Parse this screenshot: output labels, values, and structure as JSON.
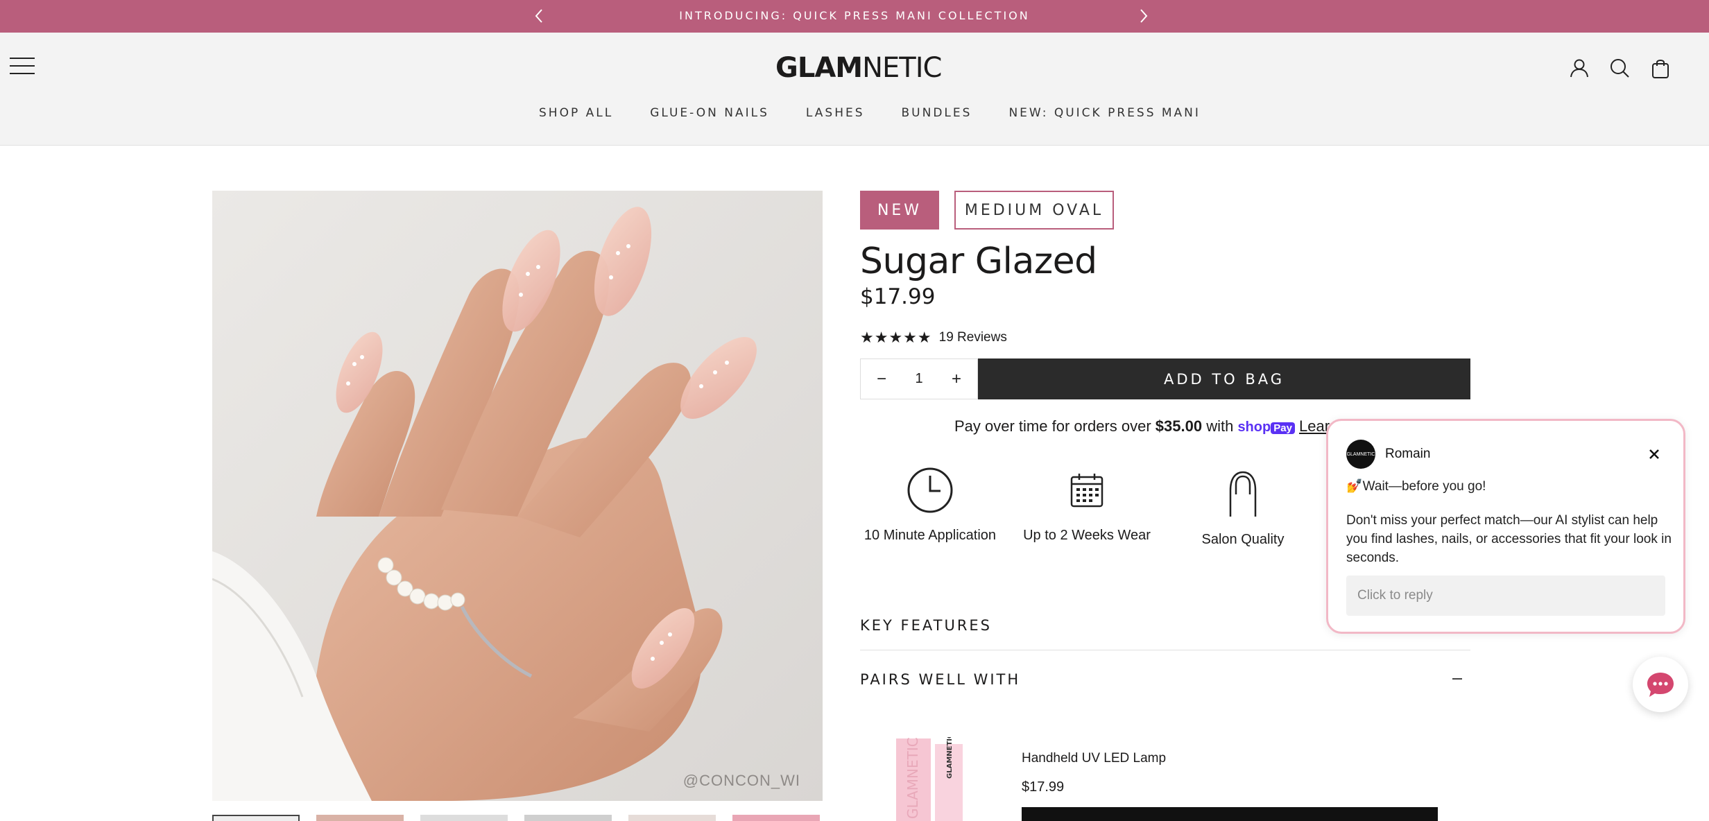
{
  "announcement": {
    "text": "INTRODUCING: QUICK PRESS MANI COLLECTION",
    "prev_icon": "chevron-left-icon",
    "next_icon": "chevron-right-icon"
  },
  "header": {
    "logo_bold": "GLAM",
    "logo_light": "NETIC",
    "nav": [
      "SHOP ALL",
      "GLUE-ON NAILS",
      "LASHES",
      "BUNDLES",
      "NEW: QUICK PRESS MANI"
    ],
    "icons": [
      "menu-icon",
      "account-icon",
      "search-icon",
      "bag-icon"
    ]
  },
  "product": {
    "badge_new": "NEW",
    "badge_shape": "MEDIUM OVAL",
    "title": "Sugar Glazed",
    "price": "$17.99",
    "stars": "★★★★★",
    "rating": 4.5,
    "reviews": "19 Reviews",
    "quantity": "1",
    "add_to_bag": "ADD TO BAG",
    "image_credit": "@CONCON_WI",
    "thumbnail_count": 6
  },
  "shoppay": {
    "prefix": "Pay over time for orders over ",
    "amount": "$35.00",
    "suffix": " with ",
    "brand_shop": "shop",
    "brand_pay": "Pay",
    "learn": "Learn more"
  },
  "features": [
    {
      "label": "10 Minute Application",
      "icon": "clock-icon"
    },
    {
      "label": "Up to 2 Weeks Wear",
      "icon": "calendar-icon"
    },
    {
      "label": "Salon Quality",
      "icon": "nail-icon"
    }
  ],
  "accordions": {
    "key_features": "KEY FEATURES",
    "pairs_well": "PAIRS WELL WITH"
  },
  "pair_item": {
    "name": "Handheld UV LED Lamp",
    "price": "$17.99",
    "packaging_text": "GLAMNETIC"
  },
  "chat": {
    "avatar_text": "GLAMNETIC",
    "agent": "Romain",
    "message1": "💅Wait—before you go!",
    "message2": "Don't miss your perfect match—our AI stylist can help you find lashes, nails, or accessories that fit your look in seconds.",
    "placeholder": "Click to reply"
  },
  "colors": {
    "brand_pink": "#b95e7c",
    "dark": "#2b2b2b",
    "shoppay": "#5a31f4"
  }
}
